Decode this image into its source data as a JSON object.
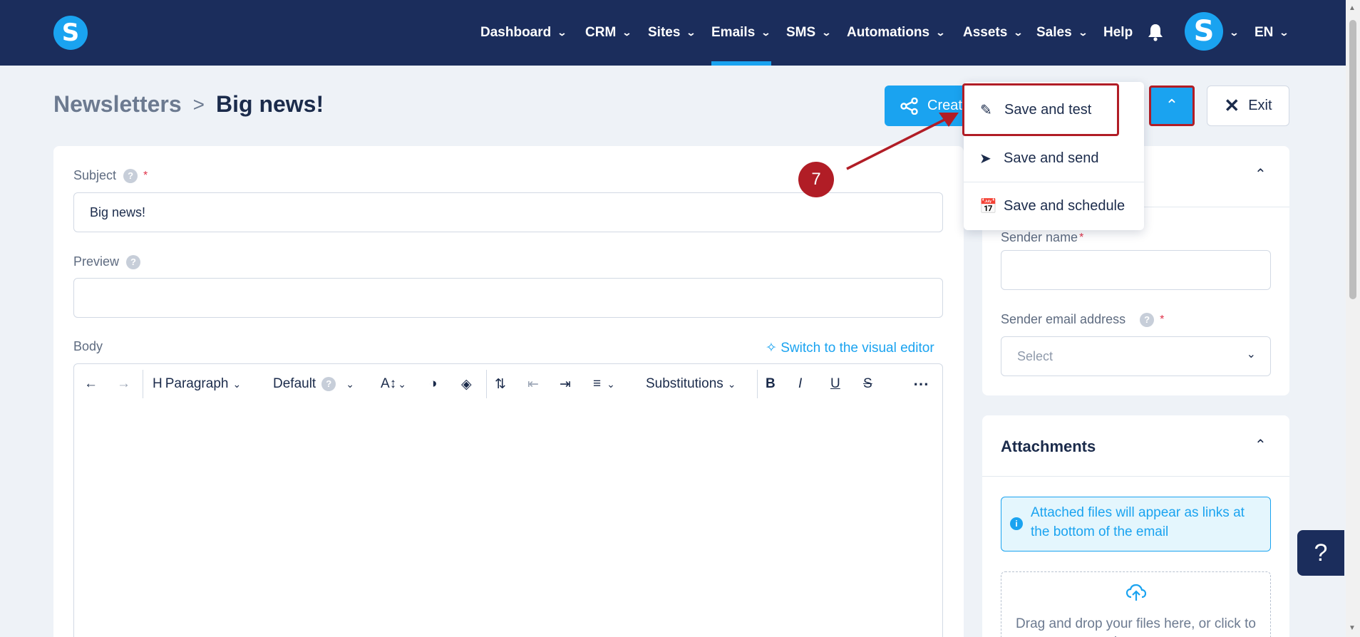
{
  "nav": {
    "items": [
      {
        "label": "Dashboard",
        "chevron": true
      },
      {
        "label": "CRM",
        "chevron": true
      },
      {
        "label": "Sites",
        "chevron": true
      },
      {
        "label": "Emails",
        "chevron": true,
        "active": true
      },
      {
        "label": "SMS",
        "chevron": true
      },
      {
        "label": "Automations",
        "chevron": true
      },
      {
        "label": "Assets",
        "chevron": true
      },
      {
        "label": "Sales",
        "chevron": true
      },
      {
        "label": "Help",
        "chevron": false
      }
    ],
    "logo_letter": "S",
    "avatar_letter": "S",
    "language": "EN"
  },
  "breadcrumb": {
    "parent": "Newsletters",
    "separator": ">",
    "current": "Big news!"
  },
  "actions": {
    "create_label": "Creat",
    "exit_label": "Exit"
  },
  "dropdown": {
    "items": [
      {
        "label": "Save and test",
        "icon": "pencil-icon"
      },
      {
        "label": "Save and send",
        "icon": "paper-plane-icon"
      },
      {
        "label": "Save and schedule",
        "icon": "calendar-clock-icon"
      }
    ]
  },
  "annotation": {
    "step": "7"
  },
  "form": {
    "subject_label": "Subject",
    "subject_value": "Big news!",
    "preview_label": "Preview",
    "preview_value": "",
    "body_label": "Body",
    "switch_editor": "Switch to the visual editor",
    "required_mark": "*",
    "help_mark": "?"
  },
  "toolbar": {
    "paragraph": "Paragraph",
    "font": "Default",
    "substitutions": "Substitutions"
  },
  "sender": {
    "name_label": "Sender name",
    "email_label": "Sender email address",
    "email_placeholder": "Select"
  },
  "attachments": {
    "title": "Attachments",
    "info": "Attached files will appear as links at the bottom of the email",
    "dropzone": "Drag and drop your files here, or click to browse"
  },
  "floating_help": "?",
  "colors": {
    "nav_bg": "#1b2d5c",
    "accent": "#1aa3f0",
    "annotation_red": "#b11d26"
  }
}
